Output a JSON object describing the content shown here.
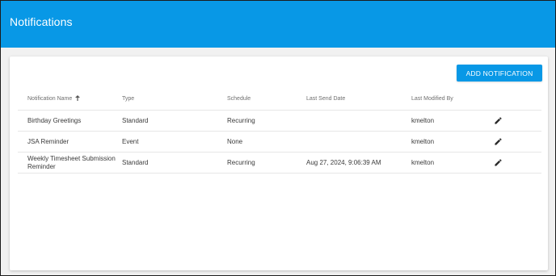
{
  "header": {
    "title": "Notifications"
  },
  "toolbar": {
    "add_label": "ADD NOTIFICATION"
  },
  "table": {
    "columns": [
      "Notification Name",
      "Type",
      "Schedule",
      "Last Send Date",
      "Last Modified By"
    ],
    "rows": [
      {
        "name": "Birthday Greetings",
        "type": "Standard",
        "schedule": "Recurring",
        "last_send": "",
        "modified_by": "kmelton"
      },
      {
        "name": "JSA Reminder",
        "type": "Event",
        "schedule": "None",
        "last_send": "",
        "modified_by": "kmelton"
      },
      {
        "name": "Weekly Timesheet Submission Reminder",
        "type": "Standard",
        "schedule": "Recurring",
        "last_send": "Aug 27, 2024, 9:06:39 AM",
        "modified_by": "kmelton"
      }
    ]
  },
  "icons": {
    "sort": "arrow-up-icon",
    "edit": "pencil-icon"
  },
  "colors": {
    "accent": "#0898e6",
    "background": "#f1f1f1"
  }
}
